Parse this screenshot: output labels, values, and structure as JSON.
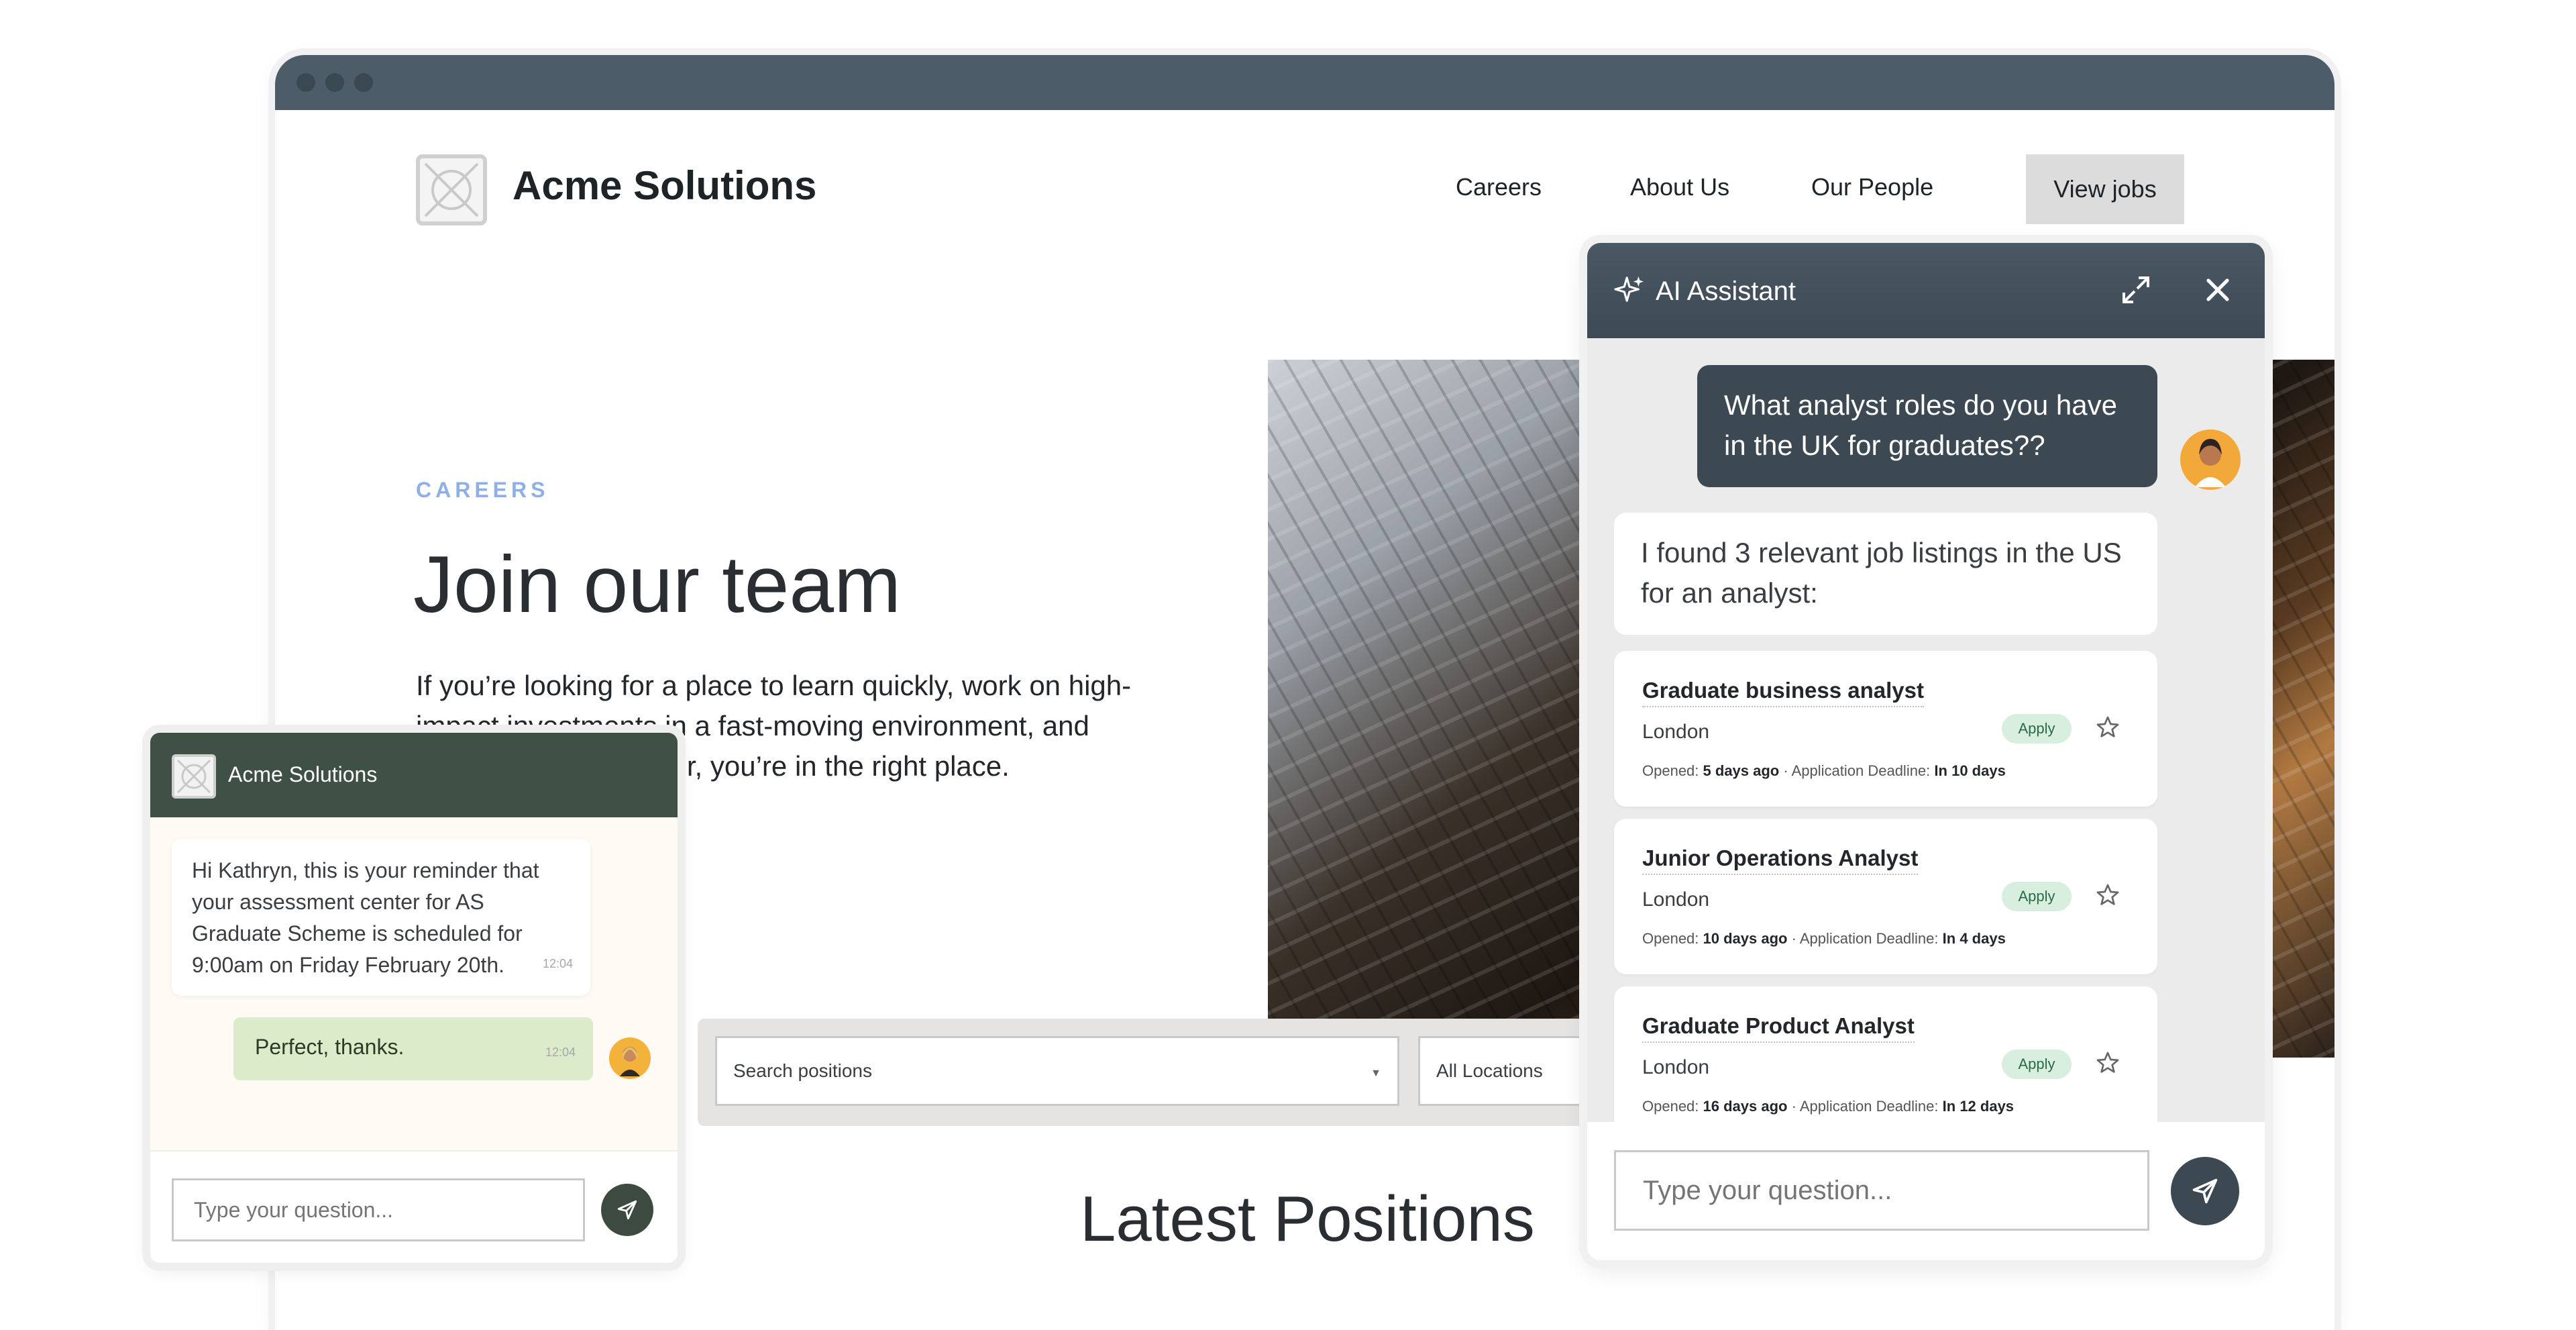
{
  "site": {
    "brand": "Acme Solutions",
    "nav": {
      "careers": "Careers",
      "about": "About Us",
      "people": "Our People",
      "view_jobs": "View jobs"
    }
  },
  "hero": {
    "eyebrow": "CAREERS",
    "title": "Join our team",
    "text": "If you’re looking for a place to learn quickly, work on high-impact investments in a fast-moving environment, and accelerate your career, you’re in the right place."
  },
  "search": {
    "positions": "Search positions",
    "locations": "All Locations"
  },
  "latest_title": "Latest Positions",
  "mini_chat": {
    "brand": "Acme Solutions",
    "reminder": "Hi Kathryn, this is your reminder that your assessment center for AS Graduate Scheme is scheduled for 9:00am on Friday February 20th.",
    "reminder_time": "12:04",
    "reply": "Perfect, thanks.",
    "reply_time": "12:04",
    "input_placeholder": "Type your question..."
  },
  "assistant": {
    "title": "AI Assistant",
    "user_message": "What analyst roles do you have in the UK for graduates??",
    "bot_message": "I found 3 relevant job listings in the US for an analyst:",
    "apply_label": "Apply",
    "opened_label": "Opened:",
    "deadline_label": "Application Deadline:",
    "jobs": [
      {
        "title": "Graduate business analyst",
        "location": "London",
        "opened": "5 days ago",
        "deadline": "In 10 days"
      },
      {
        "title": "Junior Operations Analyst",
        "location": "London",
        "opened": "10 days ago",
        "deadline": "In 4 days"
      },
      {
        "title": "Graduate Product Analyst",
        "location": "London",
        "opened": "16 days ago",
        "deadline": "In 12 days"
      }
    ],
    "input_placeholder": "Type your question..."
  },
  "colors": {
    "titlebar": "#4c5d69",
    "mini_header": "#3f5045",
    "assistant_header": "#3d4a55",
    "eyebrow": "#8fb0e6",
    "apply_bg": "#d8efe0"
  }
}
